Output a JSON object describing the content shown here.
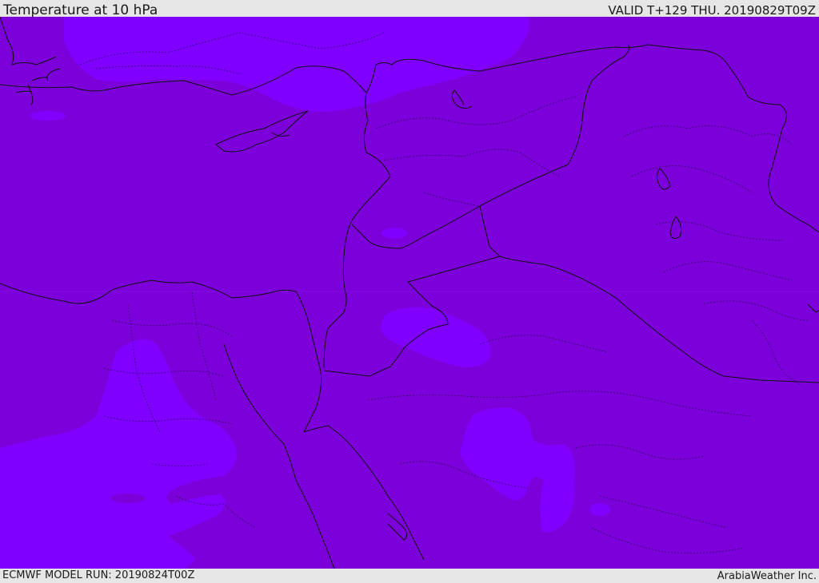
{
  "header": {
    "title": "Temperature at 10 hPa",
    "valid_time": "VALID T+129 THU. 20190829T09Z"
  },
  "footer": {
    "model_run": "ECMWF MODEL RUN: 20190824T00Z",
    "credit": "ArabiaWeather Inc."
  },
  "map": {
    "region": "Eastern Mediterranean / Middle East",
    "colors": {
      "base_fill": "#7b00d9",
      "warm_fill": "#7f00ff",
      "boundary_line": "#111111"
    }
  }
}
